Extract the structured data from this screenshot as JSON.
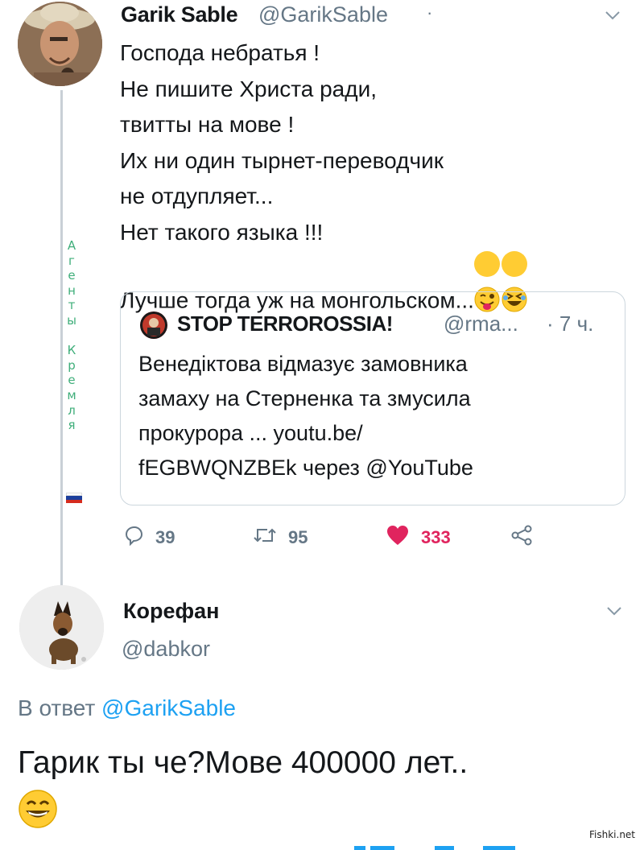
{
  "tweet1": {
    "author_name": "Garik Sable",
    "author_handle": "@GarikSable",
    "separator": "·",
    "body": "Господа небратья !\nНе пишите Христа ради,\nтвитты на мове !\nИх ни один тырнет-переводчик\nне отдупляет...\nНет такого языка !!!\nЛучше тогда уж на монгольском...",
    "emoji": [
      "winking-face-with-tongue",
      "rolling-on-floor-laughing"
    ],
    "side_label": "А г е н т ы   К р е м л я",
    "quote": {
      "name": "STOP TERROROSSIA!",
      "handle": "@rma...",
      "time": "· 7 ч.",
      "body": "Венедіктова відмазує замовника\nзамаху на Стерненка та змусила\nпрокурора ... youtu.be/\nfEGBWQNZBEk через @YouTube"
    },
    "actions": {
      "reply_count": "39",
      "retweet_count": "95",
      "like_count": "333"
    },
    "colors": {
      "like": "#e0245e",
      "muted": "#657786",
      "side_text": "#3fae7a"
    }
  },
  "tweet2": {
    "author_name": "Корефан",
    "author_handle": "@dabkor",
    "reply_prefix": "В ответ",
    "reply_mention": "@GarikSable",
    "body": "Гарик ты че?Мове 400000 лет..",
    "emoji": "grinning-face-with-smiling-eyes"
  },
  "watermark": "Fishki.net"
}
